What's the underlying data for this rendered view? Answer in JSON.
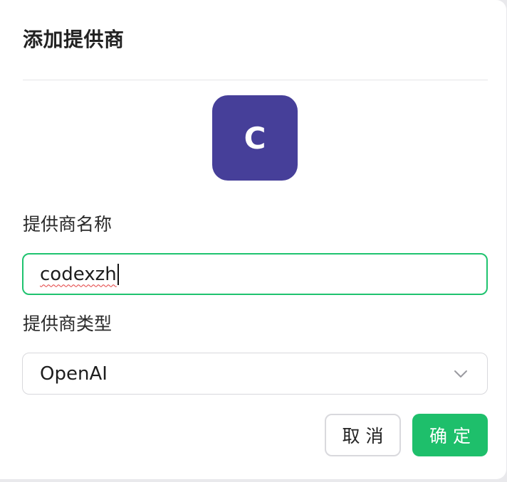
{
  "dialog": {
    "title": "添加提供商",
    "avatar": {
      "letter": "C",
      "color": "#463f99"
    },
    "name_field": {
      "label": "提供商名称",
      "value": "codexzh"
    },
    "type_field": {
      "label": "提供商类型",
      "selected": "OpenAI",
      "icon": "chevron-down-icon"
    },
    "buttons": {
      "cancel": "取消",
      "confirm": "确定"
    },
    "colors": {
      "accent": "#1ebf6b",
      "focus_border": "#1fc36f"
    }
  }
}
